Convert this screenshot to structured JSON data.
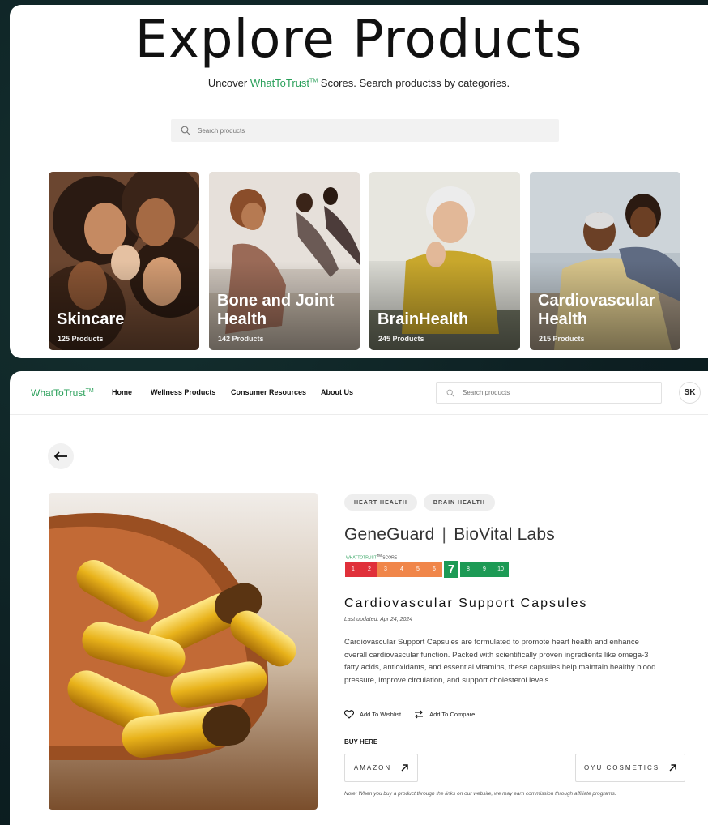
{
  "explore": {
    "title": "Explore Products",
    "subtitle_prefix": "Uncover ",
    "brand": "WhatToTrust",
    "tm": "TM",
    "subtitle_suffix": " Scores. Search productss by categories.",
    "search_placeholder": "Search products",
    "categories": [
      {
        "name": "Skincare",
        "count": "125 Products"
      },
      {
        "name": "Bone and Joint Health",
        "count": "142 Products"
      },
      {
        "name": "BrainHealth",
        "count": "245 Products"
      },
      {
        "name": "Cardiovascular Health",
        "count": "215 Products"
      }
    ]
  },
  "nav": {
    "logo": "WhatToTrust",
    "logo_tm": "TM",
    "links": [
      "Home",
      "Wellness Products",
      "Consumer Resources",
      "About Us"
    ],
    "search_placeholder": "Search products",
    "avatar": "SK"
  },
  "product": {
    "back_icon": "arrow-left-icon",
    "tags": [
      "HEART HEALTH",
      "BRAIN HEALTH"
    ],
    "name": "GeneGuard",
    "separator": "|",
    "company": "BioVital Labs",
    "score_label_brand": "WHATTOTRUST",
    "score_label_tm": "TM",
    "score_label_suffix": " SCORE",
    "score": 7,
    "score_scale": [
      "1",
      "2",
      "3",
      "4",
      "5",
      "6",
      "7",
      "8",
      "9",
      "10"
    ],
    "score_colors": {
      "low": "#e0303a",
      "mid": "#f0864a",
      "high": "#1d9a55"
    },
    "title": "Cardiovascular Support Capsules",
    "updated": "Last updated: Apr 24, 2024",
    "description": "Cardiovascular Support Capsules are formulated to promote heart health and enhance overall cardiovascular function. Packed with scientifically proven ingredients like omega-3 fatty acids, antioxidants, and essential vitamins, these capsules help maintain healthy blood pressure, improve circulation, and support cholesterol levels.",
    "wishlist": "Add To Wishlist",
    "compare": "Add To Compare",
    "buy_here": "BUY HERE",
    "stores": [
      "AMAZON",
      "OYU COSMETICS"
    ],
    "note": "Note: When you buy a product through the links on our website, we may earn commission through affiliate programs."
  }
}
